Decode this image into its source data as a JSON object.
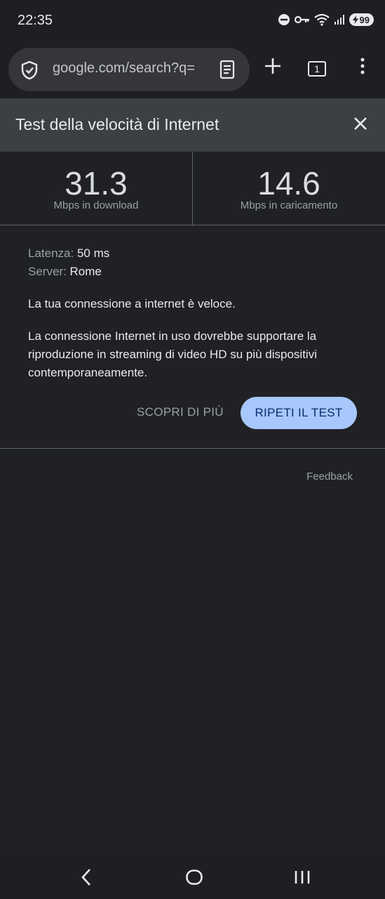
{
  "status_bar": {
    "time": "22:35",
    "battery": "99",
    "icons": [
      "do-not-disturb-icon",
      "key-icon",
      "wifi-icon",
      "signal-icon",
      "battery-icon"
    ]
  },
  "browser": {
    "url": "google.com/search?q=",
    "tab_count": "1",
    "icons": [
      "shield-icon",
      "reader-icon",
      "new-tab-icon",
      "tab-switcher-icon",
      "overflow-menu-icon"
    ]
  },
  "speed_test": {
    "title": "Test della velocità di Internet",
    "download": {
      "value": "31.3",
      "label": "Mbps in download"
    },
    "upload": {
      "value": "14.6",
      "label": "Mbps in caricamento"
    },
    "latency_label": "Latenza:",
    "latency_value": "50 ms",
    "server_label": "Server:",
    "server_value": "Rome",
    "summary": "La tua connessione a internet è veloce.",
    "description": "La connessione Internet in uso dovrebbe supportare la riproduzione in streaming di video HD su più dispositivi contemporaneamente.",
    "learn_more": "SCOPRI DI PIÙ",
    "retry": "RIPETI IL TEST",
    "feedback": "Feedback"
  },
  "colors": {
    "background": "#202124",
    "header": "#3c4043",
    "accent_button": "#a8c7fa",
    "accent_button_text": "#062e6f"
  }
}
